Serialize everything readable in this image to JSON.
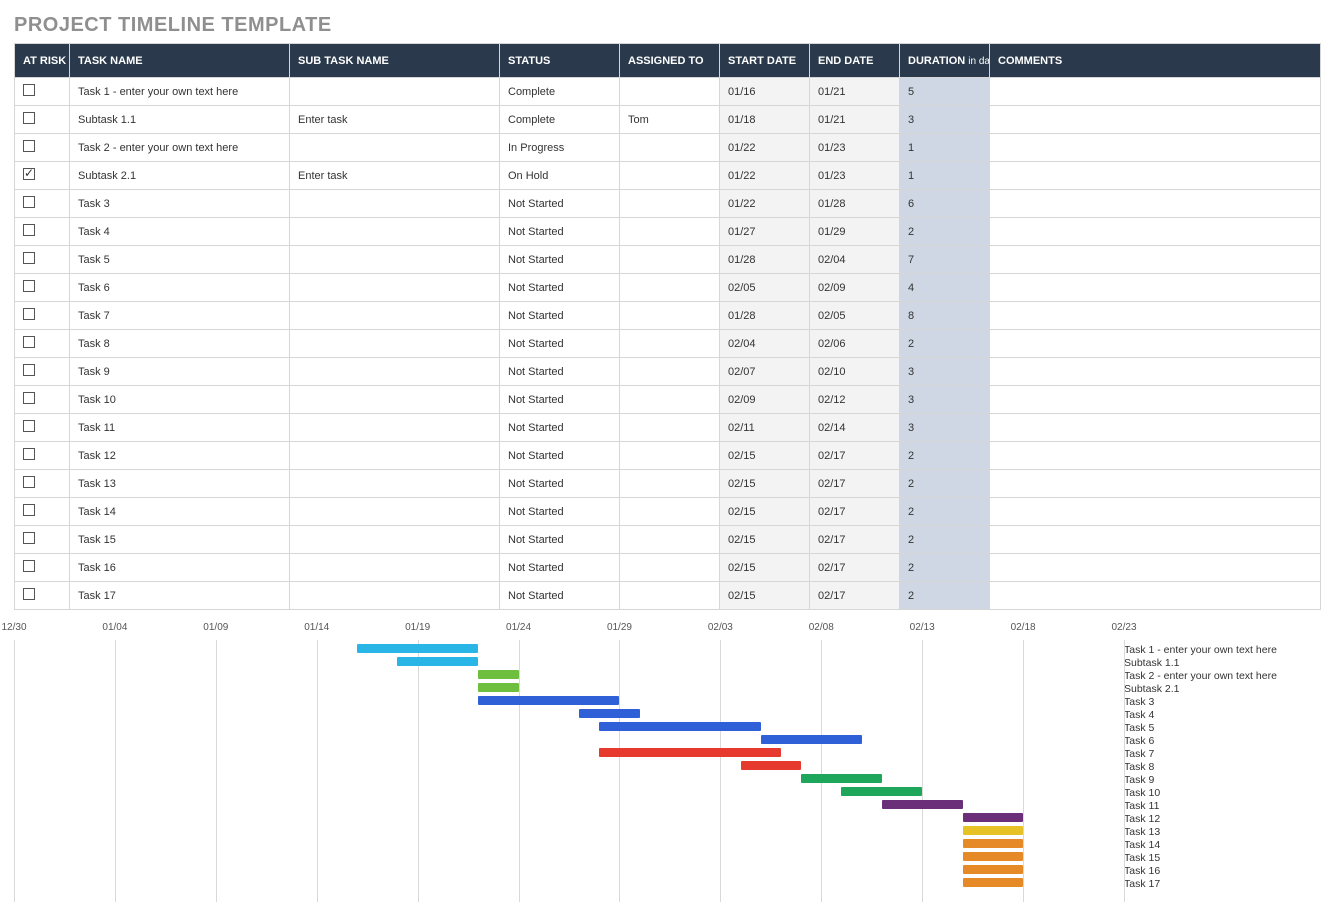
{
  "title": "PROJECT TIMELINE TEMPLATE",
  "columns": {
    "at_risk": "AT RISK",
    "task_name": "TASK NAME",
    "sub_task": "SUB TASK NAME",
    "status": "STATUS",
    "assigned": "ASSIGNED TO",
    "start": "START DATE",
    "end": "END DATE",
    "duration": "DURATION",
    "duration_sub": "in days",
    "comments": "COMMENTS"
  },
  "rows": [
    {
      "at_risk": false,
      "task": "Task 1 - enter your own text here",
      "sub": "",
      "status": "Complete",
      "assigned": "",
      "start": "01/16",
      "end": "01/21",
      "duration": "5",
      "comments": ""
    },
    {
      "at_risk": false,
      "task": "Subtask 1.1",
      "sub": "Enter task",
      "status": "Complete",
      "assigned": "Tom",
      "start": "01/18",
      "end": "01/21",
      "duration": "3",
      "comments": ""
    },
    {
      "at_risk": false,
      "task": "Task 2 - enter your own text here",
      "sub": "",
      "status": "In Progress",
      "assigned": "",
      "start": "01/22",
      "end": "01/23",
      "duration": "1",
      "comments": ""
    },
    {
      "at_risk": true,
      "task": "Subtask 2.1",
      "sub": "Enter task",
      "status": "On Hold",
      "assigned": "",
      "start": "01/22",
      "end": "01/23",
      "duration": "1",
      "comments": ""
    },
    {
      "at_risk": false,
      "task": "Task 3",
      "sub": "",
      "status": "Not Started",
      "assigned": "",
      "start": "01/22",
      "end": "01/28",
      "duration": "6",
      "comments": ""
    },
    {
      "at_risk": false,
      "task": "Task 4",
      "sub": "",
      "status": "Not Started",
      "assigned": "",
      "start": "01/27",
      "end": "01/29",
      "duration": "2",
      "comments": ""
    },
    {
      "at_risk": false,
      "task": "Task 5",
      "sub": "",
      "status": "Not Started",
      "assigned": "",
      "start": "01/28",
      "end": "02/04",
      "duration": "7",
      "comments": ""
    },
    {
      "at_risk": false,
      "task": "Task 6",
      "sub": "",
      "status": "Not Started",
      "assigned": "",
      "start": "02/05",
      "end": "02/09",
      "duration": "4",
      "comments": ""
    },
    {
      "at_risk": false,
      "task": "Task 7",
      "sub": "",
      "status": "Not Started",
      "assigned": "",
      "start": "01/28",
      "end": "02/05",
      "duration": "8",
      "comments": ""
    },
    {
      "at_risk": false,
      "task": "Task 8",
      "sub": "",
      "status": "Not Started",
      "assigned": "",
      "start": "02/04",
      "end": "02/06",
      "duration": "2",
      "comments": ""
    },
    {
      "at_risk": false,
      "task": "Task 9",
      "sub": "",
      "status": "Not Started",
      "assigned": "",
      "start": "02/07",
      "end": "02/10",
      "duration": "3",
      "comments": ""
    },
    {
      "at_risk": false,
      "task": "Task 10",
      "sub": "",
      "status": "Not Started",
      "assigned": "",
      "start": "02/09",
      "end": "02/12",
      "duration": "3",
      "comments": ""
    },
    {
      "at_risk": false,
      "task": "Task 11",
      "sub": "",
      "status": "Not Started",
      "assigned": "",
      "start": "02/11",
      "end": "02/14",
      "duration": "3",
      "comments": ""
    },
    {
      "at_risk": false,
      "task": "Task 12",
      "sub": "",
      "status": "Not Started",
      "assigned": "",
      "start": "02/15",
      "end": "02/17",
      "duration": "2",
      "comments": ""
    },
    {
      "at_risk": false,
      "task": "Task 13",
      "sub": "",
      "status": "Not Started",
      "assigned": "",
      "start": "02/15",
      "end": "02/17",
      "duration": "2",
      "comments": ""
    },
    {
      "at_risk": false,
      "task": "Task 14",
      "sub": "",
      "status": "Not Started",
      "assigned": "",
      "start": "02/15",
      "end": "02/17",
      "duration": "2",
      "comments": ""
    },
    {
      "at_risk": false,
      "task": "Task 15",
      "sub": "",
      "status": "Not Started",
      "assigned": "",
      "start": "02/15",
      "end": "02/17",
      "duration": "2",
      "comments": ""
    },
    {
      "at_risk": false,
      "task": "Task 16",
      "sub": "",
      "status": "Not Started",
      "assigned": "",
      "start": "02/15",
      "end": "02/17",
      "duration": "2",
      "comments": ""
    },
    {
      "at_risk": false,
      "task": "Task 17",
      "sub": "",
      "status": "Not Started",
      "assigned": "",
      "start": "02/15",
      "end": "02/17",
      "duration": "2",
      "comments": ""
    }
  ],
  "chart_data": {
    "type": "bar",
    "title": "",
    "xlabel": "",
    "ylabel": "",
    "x_range_days": [
      "12/30",
      "02/23"
    ],
    "x_ticks": [
      "12/30",
      "01/04",
      "01/09",
      "01/14",
      "01/19",
      "01/24",
      "01/29",
      "02/03",
      "02/08",
      "02/13",
      "02/18",
      "02/23"
    ],
    "series": [
      {
        "name": "Task 1 - enter your own text here",
        "start": "01/16",
        "end": "01/21",
        "color": "#29b6e6"
      },
      {
        "name": "Subtask 1.1",
        "start": "01/18",
        "end": "01/21",
        "color": "#29b6e6"
      },
      {
        "name": "Task 2 - enter your own text here",
        "start": "01/22",
        "end": "01/23",
        "color": "#6fbf3f"
      },
      {
        "name": "Subtask 2.1",
        "start": "01/22",
        "end": "01/23",
        "color": "#6fbf3f"
      },
      {
        "name": "Task 3",
        "start": "01/22",
        "end": "01/28",
        "color": "#3060d8"
      },
      {
        "name": "Task 4",
        "start": "01/27",
        "end": "01/29",
        "color": "#3060d8"
      },
      {
        "name": "Task 5",
        "start": "01/28",
        "end": "02/04",
        "color": "#3060d8"
      },
      {
        "name": "Task 6",
        "start": "02/05",
        "end": "02/09",
        "color": "#3060d8"
      },
      {
        "name": "Task 7",
        "start": "01/28",
        "end": "02/05",
        "color": "#e63a2e"
      },
      {
        "name": "Task 8",
        "start": "02/04",
        "end": "02/06",
        "color": "#e63a2e"
      },
      {
        "name": "Task 9",
        "start": "02/07",
        "end": "02/10",
        "color": "#1ea65a"
      },
      {
        "name": "Task 10",
        "start": "02/09",
        "end": "02/12",
        "color": "#1ea65a"
      },
      {
        "name": "Task 11",
        "start": "02/11",
        "end": "02/14",
        "color": "#6b2e78"
      },
      {
        "name": "Task 12",
        "start": "02/15",
        "end": "02/17",
        "color": "#6b2e78"
      },
      {
        "name": "Task 13",
        "start": "02/15",
        "end": "02/17",
        "color": "#e6c227"
      },
      {
        "name": "Task 14",
        "start": "02/15",
        "end": "02/17",
        "color": "#e68a27"
      },
      {
        "name": "Task 15",
        "start": "02/15",
        "end": "02/17",
        "color": "#e68a27"
      },
      {
        "name": "Task 16",
        "start": "02/15",
        "end": "02/17",
        "color": "#e68a27"
      },
      {
        "name": "Task 17",
        "start": "02/15",
        "end": "02/17",
        "color": "#e68a27"
      }
    ]
  }
}
